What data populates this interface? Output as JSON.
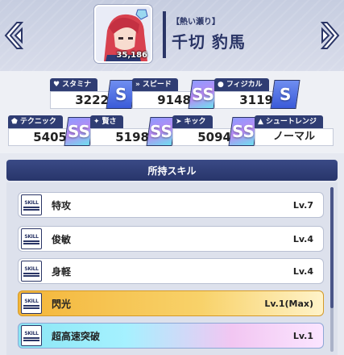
{
  "header": {
    "portrait_value": "35,186",
    "subtitle": "【熱い瀬り】",
    "name": "千切 豹馬"
  },
  "stats": [
    {
      "label": "スタミナ",
      "icon": "heart-icon",
      "value": "3222",
      "grade": "S"
    },
    {
      "label": "スピード",
      "icon": "speed-icon",
      "value": "9148",
      "grade": "SS"
    },
    {
      "label": "フィジカル",
      "icon": "muscle-icon",
      "value": "3119",
      "grade": "S"
    },
    {
      "label": "テクニック",
      "icon": "pentagon-icon",
      "value": "5405",
      "grade": "SS"
    },
    {
      "label": "賢さ",
      "icon": "sparkle-icon",
      "value": "5198",
      "grade": "SS"
    },
    {
      "label": "キック",
      "icon": "kick-icon",
      "value": "5094",
      "grade": "SS"
    },
    {
      "label": "シュートレンジ",
      "icon": "triangle-icon",
      "value": "ノーマル",
      "grade": ""
    }
  ],
  "skills": {
    "title": "所持スキル",
    "badge_text": "SKILL",
    "items": [
      {
        "name": "特攻",
        "level": "Lv.7",
        "style": "normal"
      },
      {
        "name": "俊敏",
        "level": "Lv.4",
        "style": "normal"
      },
      {
        "name": "身軽",
        "level": "Lv.4",
        "style": "normal"
      },
      {
        "name": "閃光",
        "level": "Lv.1(Max)",
        "style": "gold"
      },
      {
        "name": "超高速突破",
        "level": "Lv.1",
        "style": "rainbow"
      }
    ]
  }
}
